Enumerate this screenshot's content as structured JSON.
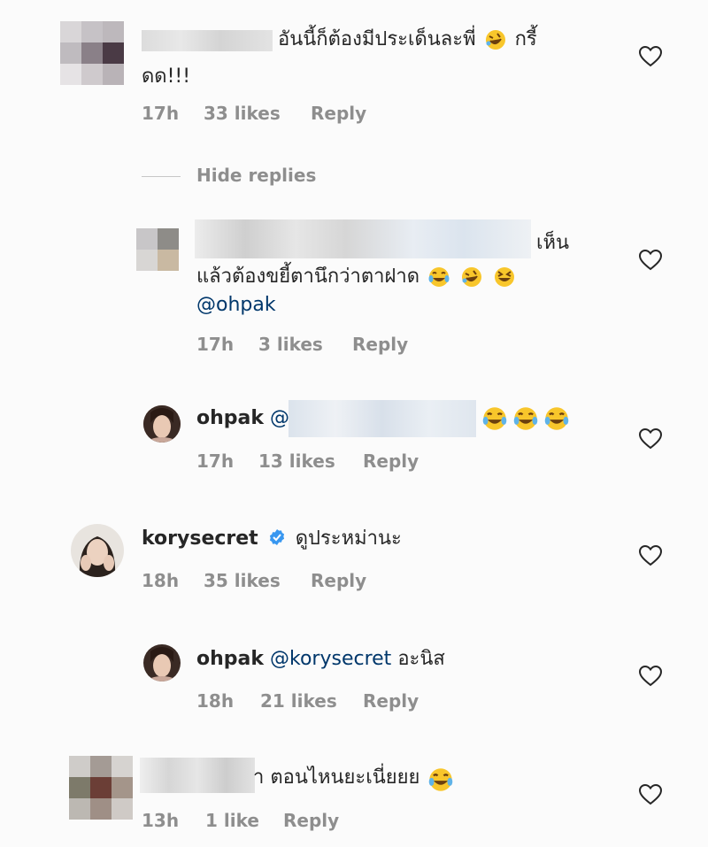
{
  "comments": [
    {
      "text": "อันนี้ก็ต้องมีประเด็นละพี่",
      "text_cont": "กรี้",
      "text_line2": "ดด!!!",
      "time": "17h",
      "likes": "33 likes",
      "reply": "Reply"
    },
    {
      "hide_replies": "Hide replies"
    },
    {
      "text_a": "เห็น",
      "text_b": "แล้วต้องขยี้ตานึกว่าตาฝาด",
      "mention": "@ohpak",
      "time": "17h",
      "likes": "3 likes",
      "reply": "Reply"
    },
    {
      "username": "ohpak",
      "mention_prefix": "@",
      "time": "17h",
      "likes": "13 likes",
      "reply": "Reply"
    },
    {
      "username": "korysecret",
      "text": "ดูประหม่านะ",
      "time": "18h",
      "likes": "35 likes",
      "reply": "Reply"
    },
    {
      "username": "ohpak",
      "mention": "@korysecret",
      "text": "อะนิส",
      "time": "18h",
      "likes": "21 likes",
      "reply": "Reply"
    },
    {
      "text_prefix": "า",
      "text": "ตอนไหนยะเนี่ยยย",
      "time": "13h",
      "likes": "1 like",
      "reply": "Reply"
    }
  ],
  "icons": {
    "heart": "heart-outline-icon",
    "verified": "verified-badge-icon"
  },
  "colors": {
    "meta": "#8e8e8e",
    "mention": "#00376b",
    "verified": "#3897f0"
  }
}
